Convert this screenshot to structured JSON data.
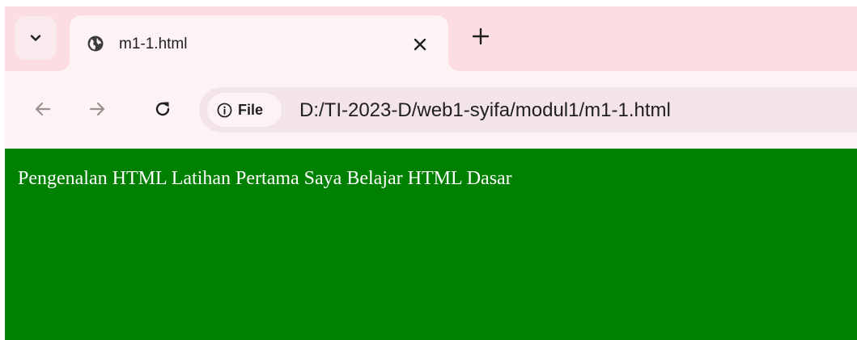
{
  "browser": {
    "tab": {
      "title": "m1-1.html",
      "favicon": "globe-icon"
    },
    "tab_search_icon": "chevron-down-icon",
    "close_icon": "close-icon",
    "new_tab_icon": "plus-icon",
    "nav": {
      "back_icon": "arrow-left-icon",
      "forward_icon": "arrow-right-icon",
      "reload_icon": "reload-icon"
    },
    "address_bar": {
      "chip_label": "File",
      "chip_icon": "info-icon",
      "url": "D:/TI-2023-D/web1-syifa/modul1/m1-1.html"
    }
  },
  "page": {
    "background_color": "#008000",
    "text_color": "#ffffff",
    "body_text": "Pengenalan HTML Latihan Pertama Saya Belajar HTML Dasar"
  },
  "colors": {
    "tabstrip_bg": "#fcdde2",
    "toolbar_bg": "#fdf3f4",
    "omnibox_bg": "#f3e4e8"
  }
}
